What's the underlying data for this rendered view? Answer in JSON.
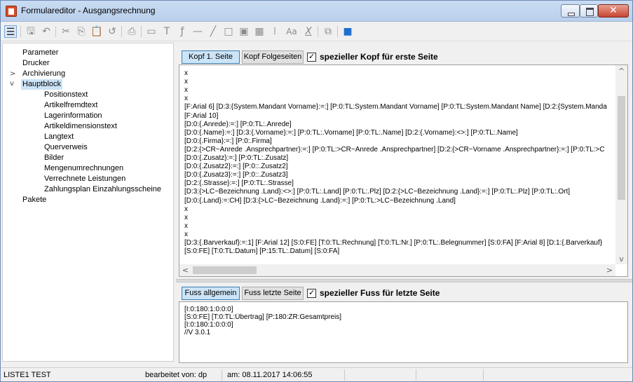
{
  "window": {
    "title": "Formulareditor - Ausgangsrechnung",
    "close_glyph": "✕"
  },
  "toolbar": {
    "icons": [
      {
        "name": "tree-toggle-icon",
        "glyph": "☰"
      },
      {
        "name": "save-icon",
        "glyph": "🖫"
      },
      {
        "name": "undo-icon",
        "glyph": "↶"
      },
      {
        "name": "cut-icon",
        "glyph": "✂"
      },
      {
        "name": "copy-icon",
        "glyph": "⎘"
      },
      {
        "name": "paste-icon",
        "glyph": "📋"
      },
      {
        "name": "undo-small-icon",
        "glyph": "↺"
      },
      {
        "name": "print-preview-icon",
        "glyph": "⎙"
      },
      {
        "name": "field-icon",
        "glyph": "▭"
      },
      {
        "name": "text-icon",
        "glyph": "T"
      },
      {
        "name": "formula-icon",
        "glyph": "ƒ"
      },
      {
        "name": "horizontal-line-icon",
        "glyph": "—"
      },
      {
        "name": "diagonal-line-icon",
        "glyph": "╱"
      },
      {
        "name": "rectangle-icon",
        "glyph": "□"
      },
      {
        "name": "image-icon",
        "glyph": "▣"
      },
      {
        "name": "table-icon",
        "glyph": "▦"
      },
      {
        "name": "barcode-icon",
        "glyph": "⁞"
      },
      {
        "name": "font-icon",
        "glyph": "Aa"
      },
      {
        "name": "italic-x-icon",
        "glyph": "X"
      },
      {
        "name": "clipboard-icon",
        "glyph": "⧉"
      },
      {
        "name": "exit-icon",
        "glyph": "■"
      }
    ]
  },
  "tree": {
    "items": [
      {
        "label": "Parameter",
        "level": 0
      },
      {
        "label": "Drucker",
        "level": 0
      },
      {
        "label": "Archivierung",
        "level": 0,
        "chevron": ">"
      },
      {
        "label": "Hauptblock",
        "level": 0,
        "chevron": "v",
        "selected": true
      },
      {
        "label": "Positionstext",
        "level": 1
      },
      {
        "label": "Artikelfremdtext",
        "level": 1
      },
      {
        "label": "Lagerinformation",
        "level": 1
      },
      {
        "label": "Artikeldimensionstext",
        "level": 1
      },
      {
        "label": "Langtext",
        "level": 1
      },
      {
        "label": "Querverweis",
        "level": 1
      },
      {
        "label": "Bilder",
        "level": 1
      },
      {
        "label": "Mengenumrechnungen",
        "level": 1
      },
      {
        "label": "Verrechnete Leistungen",
        "level": 1
      },
      {
        "label": "Zahlungsplan Einzahlungsscheine",
        "level": 1
      },
      {
        "label": "Pakete",
        "level": 0
      }
    ]
  },
  "header_section": {
    "tab1": "Kopf 1. Seite",
    "tab2": "Kopf Folgeseiten",
    "checkbox_label": "spezieller Kopf für erste Seite",
    "lines": [
      "x",
      "x",
      "x",
      "x",
      "[F:Arial 6] [D:3:{System.Mandant Vorname}:=:] [P:0:TL:System.Mandant Vorname] [P:0:TL:System.Mandant Name] [D:2:{System.Manda",
      "[F:Arial 10]",
      "[D:0:{.Anrede}:=:]  [P:0:TL:.Anrede]",
      "[D:0:{.Name}:=:]  [D:3:{.Vorname}:=:] [P:0:TL:.Vorname] [P:0:TL:.Name]  [D:2:{.Vorname}:<>:] [P:0:TL:.Name]",
      "[D:0:{.Firma}:=:]  [P:0:.Firma]",
      "[D:2:{>CR~Anrede .Ansprechpartner}:=:] [P:0:TL:>CR~Anrede .Ansprechpartner] [D:2:{>CR~Vorname .Ansprechpartner}:=:] [P:0:TL:>C",
      "[D:0:{.Zusatz}:=:] [P:0:TL:.Zusatz]",
      "[D:0:{.Zusatz2}:=:] [P:0::.Zusatz2]",
      "[D:0:{.Zusatz3}:=:] [P:0::.Zusatz3]",
      "[D:2:{.Strasse}:=:] [P:0:TL:.Strasse]",
      "[D:3:{>LC~Bezeichnung .Land}:<>:]  [P:0:TL:.Land] [P:0:TL:.Plz] [D:2:{>LC~Bezeichnung .Land}:=:] [P:0:TL:.Plz] [P:0:TL:.Ort]",
      "[D:0:{.Land}:=:CH]   [D:3:{>LC~Bezeichnung .Land}:=:]  [P:0:TL:>LC~Bezeichnung .Land]",
      "x",
      "x",
      "x",
      "x",
      "[D:3:{.Barverkauf}:=:1] [F:Arial 12] [S:0:FE] [T:0:TL:Rechnung] [T:0:TL:Nr.] [P:0:TL:.Belegnummer] [S:0:FA] [F:Arial 8] [D:1:{.Barverkauf}",
      "[S:0:FE] [T:0:TL:Datum] [P:15:TL:.Datum] [S:0:FA]"
    ]
  },
  "footer_section": {
    "tab1": "Fuss allgemein",
    "tab2": "Fuss letzte Seite",
    "checkbox_label": "spezieller Fuss für letzte Seite",
    "lines": [
      "[I:0:180:1:0:0:0]",
      "[S:0:FE] [T:0:TL:Übertrag] [P:180:ZR:Gesamtpreis]",
      "[I:0:180:1:0:0:0]",
      "//V 3.0.1"
    ]
  },
  "statusbar": {
    "list_name": "LISTE1 TEST",
    "edited_by": "bearbeitet von: dp",
    "edited_at": "am: 08.11.2017 14:06:55"
  },
  "scroll_arrows": {
    "up": "^",
    "down": "v",
    "left": "<",
    "right": ">"
  }
}
